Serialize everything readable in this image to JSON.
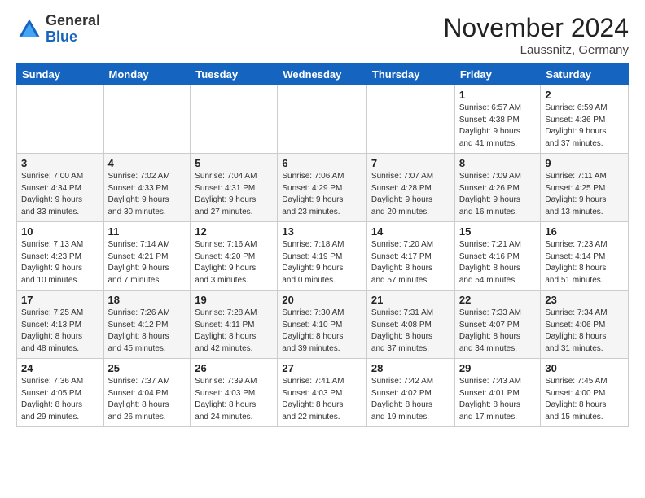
{
  "header": {
    "logo": {
      "general": "General",
      "blue": "Blue"
    },
    "title": "November 2024",
    "location": "Laussnitz, Germany"
  },
  "weekdays": [
    "Sunday",
    "Monday",
    "Tuesday",
    "Wednesday",
    "Thursday",
    "Friday",
    "Saturday"
  ],
  "weeks": [
    [
      {
        "day": null,
        "info": null
      },
      {
        "day": null,
        "info": null
      },
      {
        "day": null,
        "info": null
      },
      {
        "day": null,
        "info": null
      },
      {
        "day": null,
        "info": null
      },
      {
        "day": "1",
        "info": "Sunrise: 6:57 AM\nSunset: 4:38 PM\nDaylight: 9 hours\nand 41 minutes."
      },
      {
        "day": "2",
        "info": "Sunrise: 6:59 AM\nSunset: 4:36 PM\nDaylight: 9 hours\nand 37 minutes."
      }
    ],
    [
      {
        "day": "3",
        "info": "Sunrise: 7:00 AM\nSunset: 4:34 PM\nDaylight: 9 hours\nand 33 minutes."
      },
      {
        "day": "4",
        "info": "Sunrise: 7:02 AM\nSunset: 4:33 PM\nDaylight: 9 hours\nand 30 minutes."
      },
      {
        "day": "5",
        "info": "Sunrise: 7:04 AM\nSunset: 4:31 PM\nDaylight: 9 hours\nand 27 minutes."
      },
      {
        "day": "6",
        "info": "Sunrise: 7:06 AM\nSunset: 4:29 PM\nDaylight: 9 hours\nand 23 minutes."
      },
      {
        "day": "7",
        "info": "Sunrise: 7:07 AM\nSunset: 4:28 PM\nDaylight: 9 hours\nand 20 minutes."
      },
      {
        "day": "8",
        "info": "Sunrise: 7:09 AM\nSunset: 4:26 PM\nDaylight: 9 hours\nand 16 minutes."
      },
      {
        "day": "9",
        "info": "Sunrise: 7:11 AM\nSunset: 4:25 PM\nDaylight: 9 hours\nand 13 minutes."
      }
    ],
    [
      {
        "day": "10",
        "info": "Sunrise: 7:13 AM\nSunset: 4:23 PM\nDaylight: 9 hours\nand 10 minutes."
      },
      {
        "day": "11",
        "info": "Sunrise: 7:14 AM\nSunset: 4:21 PM\nDaylight: 9 hours\nand 7 minutes."
      },
      {
        "day": "12",
        "info": "Sunrise: 7:16 AM\nSunset: 4:20 PM\nDaylight: 9 hours\nand 3 minutes."
      },
      {
        "day": "13",
        "info": "Sunrise: 7:18 AM\nSunset: 4:19 PM\nDaylight: 9 hours\nand 0 minutes."
      },
      {
        "day": "14",
        "info": "Sunrise: 7:20 AM\nSunset: 4:17 PM\nDaylight: 8 hours\nand 57 minutes."
      },
      {
        "day": "15",
        "info": "Sunrise: 7:21 AM\nSunset: 4:16 PM\nDaylight: 8 hours\nand 54 minutes."
      },
      {
        "day": "16",
        "info": "Sunrise: 7:23 AM\nSunset: 4:14 PM\nDaylight: 8 hours\nand 51 minutes."
      }
    ],
    [
      {
        "day": "17",
        "info": "Sunrise: 7:25 AM\nSunset: 4:13 PM\nDaylight: 8 hours\nand 48 minutes."
      },
      {
        "day": "18",
        "info": "Sunrise: 7:26 AM\nSunset: 4:12 PM\nDaylight: 8 hours\nand 45 minutes."
      },
      {
        "day": "19",
        "info": "Sunrise: 7:28 AM\nSunset: 4:11 PM\nDaylight: 8 hours\nand 42 minutes."
      },
      {
        "day": "20",
        "info": "Sunrise: 7:30 AM\nSunset: 4:10 PM\nDaylight: 8 hours\nand 39 minutes."
      },
      {
        "day": "21",
        "info": "Sunrise: 7:31 AM\nSunset: 4:08 PM\nDaylight: 8 hours\nand 37 minutes."
      },
      {
        "day": "22",
        "info": "Sunrise: 7:33 AM\nSunset: 4:07 PM\nDaylight: 8 hours\nand 34 minutes."
      },
      {
        "day": "23",
        "info": "Sunrise: 7:34 AM\nSunset: 4:06 PM\nDaylight: 8 hours\nand 31 minutes."
      }
    ],
    [
      {
        "day": "24",
        "info": "Sunrise: 7:36 AM\nSunset: 4:05 PM\nDaylight: 8 hours\nand 29 minutes."
      },
      {
        "day": "25",
        "info": "Sunrise: 7:37 AM\nSunset: 4:04 PM\nDaylight: 8 hours\nand 26 minutes."
      },
      {
        "day": "26",
        "info": "Sunrise: 7:39 AM\nSunset: 4:03 PM\nDaylight: 8 hours\nand 24 minutes."
      },
      {
        "day": "27",
        "info": "Sunrise: 7:41 AM\nSunset: 4:03 PM\nDaylight: 8 hours\nand 22 minutes."
      },
      {
        "day": "28",
        "info": "Sunrise: 7:42 AM\nSunset: 4:02 PM\nDaylight: 8 hours\nand 19 minutes."
      },
      {
        "day": "29",
        "info": "Sunrise: 7:43 AM\nSunset: 4:01 PM\nDaylight: 8 hours\nand 17 minutes."
      },
      {
        "day": "30",
        "info": "Sunrise: 7:45 AM\nSunset: 4:00 PM\nDaylight: 8 hours\nand 15 minutes."
      }
    ]
  ]
}
